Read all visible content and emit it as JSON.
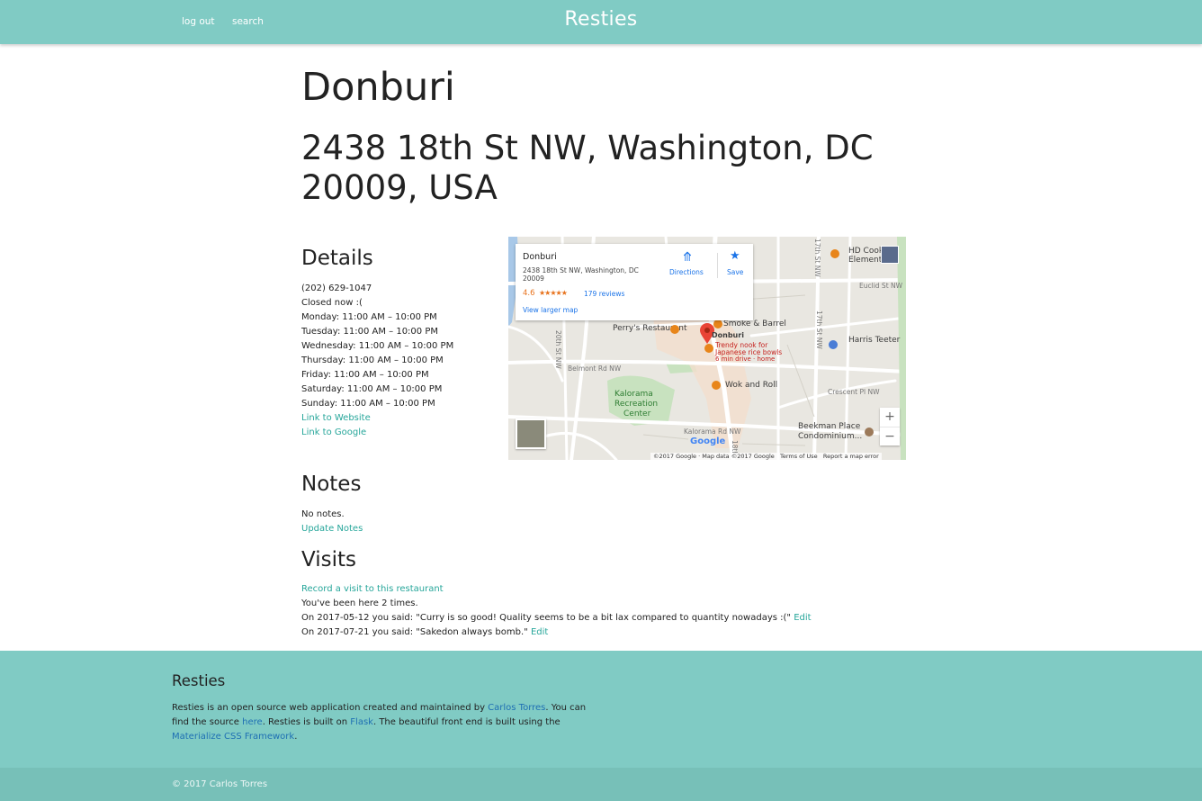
{
  "nav": {
    "logout_label": "log out",
    "search_label": "search",
    "brand": "Resties",
    "color": "#80cbc4"
  },
  "restaurant": {
    "name": "Donburi",
    "address": "2438 18th St NW, Washington, DC 20009, USA"
  },
  "details": {
    "heading": "Details",
    "phone": "(202) 629-1047",
    "status": "Closed now :(",
    "hours": [
      "Monday: 11:00 AM – 10:00 PM",
      "Tuesday: 11:00 AM – 10:00 PM",
      "Wednesday: 11:00 AM – 10:00 PM",
      "Thursday: 11:00 AM – 10:00 PM",
      "Friday: 11:00 AM – 10:00 PM",
      "Saturday: 11:00 AM – 10:00 PM",
      "Sunday: 11:00 AM – 10:00 PM"
    ],
    "website_link": "Link to Website",
    "google_link": "Link to Google"
  },
  "map": {
    "card": {
      "name": "Donburi",
      "address": "2438 18th St NW, Washington, DC 20009",
      "rating": "4.6",
      "stars": "★★★★★",
      "reviews": "179 reviews",
      "larger_map": "View larger map",
      "directions": "Directions",
      "save": "Save"
    },
    "places": {
      "hd_cook": "HD Cook",
      "hd_cook_2": "Elementa",
      "smoke_barrel": "Smoke & Barrel",
      "perrys": "Perry's Restaurant",
      "donburi": "Donburi",
      "donburi_desc_1": "Trendy nook for",
      "donburi_desc_2": "Japanese rice bowls",
      "donburi_desc_3": "6 min drive · home",
      "harris_teeter": "Harris Teeter",
      "wok_roll": "Wok and Roll",
      "kalorama_1": "Kalorama",
      "kalorama_2": "Recreation",
      "kalorama_3": "Center",
      "beekman_1": "Beekman Place",
      "beekman_2": "Condominium..."
    },
    "streets": {
      "euclid": "Euclid St NW",
      "belmont": "Belmont Rd NW",
      "kalorama_rd": "Kalorama Rd NW",
      "crescent": "Crescent Pl NW",
      "twentieth": "20th St NW",
      "seventeenth": "17th St NW",
      "seventeenth_2": "17th St NW",
      "eighteenth": "18th"
    },
    "google_logo": "Google",
    "footer": {
      "copyright": "©2017 Google · Map data ©2017 Google",
      "terms": "Terms of Use",
      "report": "Report a map error"
    }
  },
  "notes": {
    "heading": "Notes",
    "text": "No notes.",
    "update_link": "Update Notes"
  },
  "visits": {
    "heading": "Visits",
    "record_link": "Record a visit to this restaurant",
    "count_text": "You've been here 2 times.",
    "entries": [
      {
        "text": "On 2017-05-12 you said: \"Curry is so good! Quality seems to be a bit lax compared to quantity nowadays :(\"",
        "edit": "Edit"
      },
      {
        "text": "On 2017-07-21 you said: \"Sakedon always bomb.\"",
        "edit": "Edit"
      }
    ]
  },
  "footer": {
    "title": "Resties",
    "t1": "Resties is an open source web application created and maintained by ",
    "author_link": "Carlos Torres",
    "t2": ". You can find the source ",
    "here_link": "here",
    "t3": ". Resties is built on ",
    "flask_link": "Flask",
    "t4": ". The beautiful front end is built using the ",
    "materialize_link": "Materialize CSS Framework",
    "t5": ".",
    "copyright": "© 2017 Carlos Torres"
  }
}
